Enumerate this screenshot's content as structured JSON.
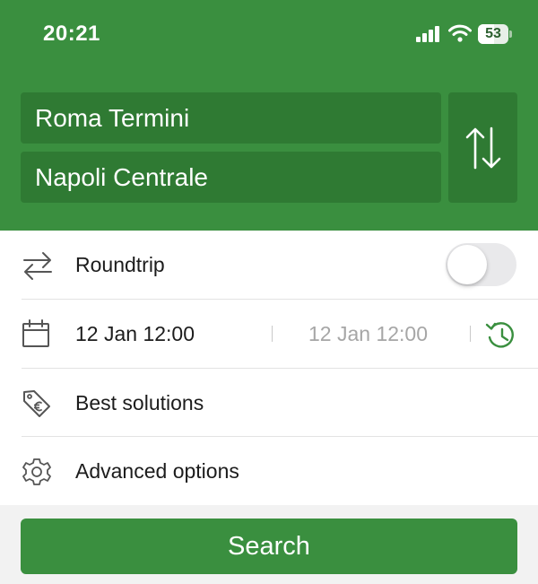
{
  "status_bar": {
    "time": "20:21",
    "battery": "53",
    "battery_level": 0.53
  },
  "route": {
    "from": "Roma Termini",
    "to": "Napoli Centrale"
  },
  "options": {
    "roundtrip": {
      "label": "Roundtrip",
      "enabled": false
    },
    "dates": {
      "departure": "12 Jan 12:00",
      "return": "12 Jan 12:00"
    },
    "best_solutions": {
      "label": "Best solutions"
    },
    "advanced_options": {
      "label": "Advanced options"
    }
  },
  "search_button": {
    "label": "Search"
  },
  "icons": {
    "signal": "signal-icon",
    "wifi": "wifi-icon",
    "battery": "battery-icon",
    "swap": "swap-vertical-icon",
    "roundtrip": "roundtrip-arrows-icon",
    "calendar": "calendar-icon",
    "clock": "history-clock-icon",
    "tag": "euro-tag-icon",
    "gear": "gear-icon"
  },
  "colors": {
    "brand_green": "#3a8f3f",
    "field_green": "#2f7a33",
    "disabled_text": "#a6a6a6",
    "icon_gray": "#555555"
  }
}
